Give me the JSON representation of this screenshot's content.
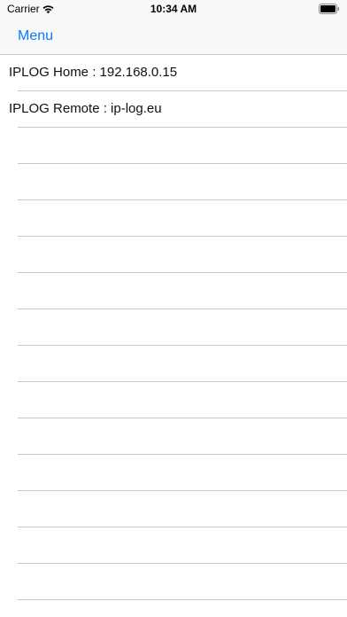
{
  "status_bar": {
    "carrier": "Carrier",
    "time": "10:34 AM",
    "icons": [
      "wifi-icon",
      "battery-icon"
    ]
  },
  "nav": {
    "back_label": "Menu",
    "accent": "#0a7aff"
  },
  "rows": [
    {
      "label": "IPLOG Home : 192.168.0.15"
    },
    {
      "label": "IPLOG Remote : ip-log.eu"
    }
  ],
  "colors": {
    "separator": "#c8c7cc",
    "bar_background": "#f8f8f8"
  }
}
